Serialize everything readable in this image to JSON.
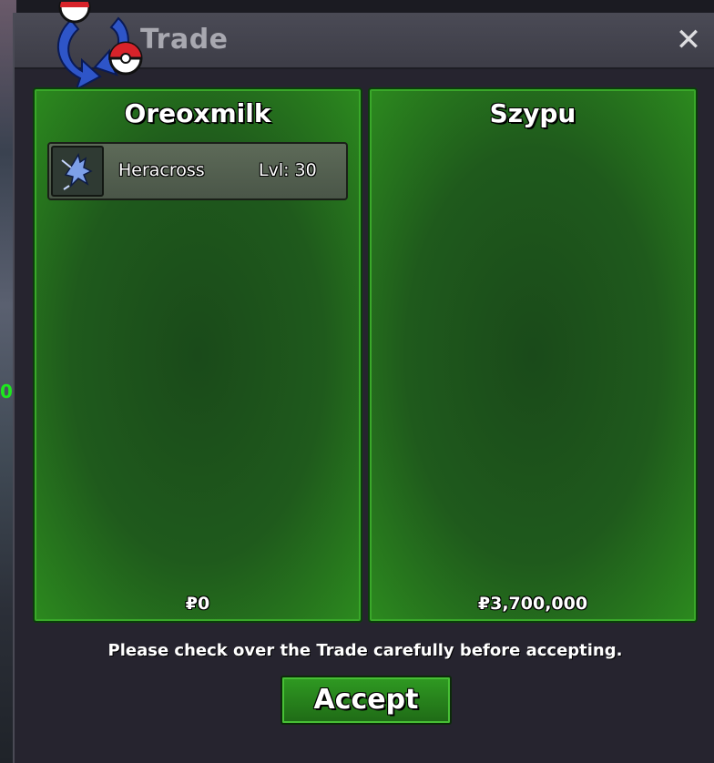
{
  "window": {
    "title": "Trade",
    "close_symbol": "✕"
  },
  "left_panel": {
    "player_name": "Oreoxmilk",
    "items": [
      {
        "name": "Heracross",
        "level": "Lvl: 30",
        "icon": "heracross-sprite-icon"
      }
    ],
    "money": "₽0"
  },
  "right_panel": {
    "player_name": "Szypu",
    "items": [],
    "money": "₽3,700,000"
  },
  "footer": {
    "notice": "Please check over the Trade carefully before accepting.",
    "accept_label": "Accept"
  },
  "colors": {
    "panel_green": "#1f5a1c",
    "panel_border": "#3aa82a",
    "window_bg": "#26242f",
    "title_text": "#a8a8b0"
  }
}
